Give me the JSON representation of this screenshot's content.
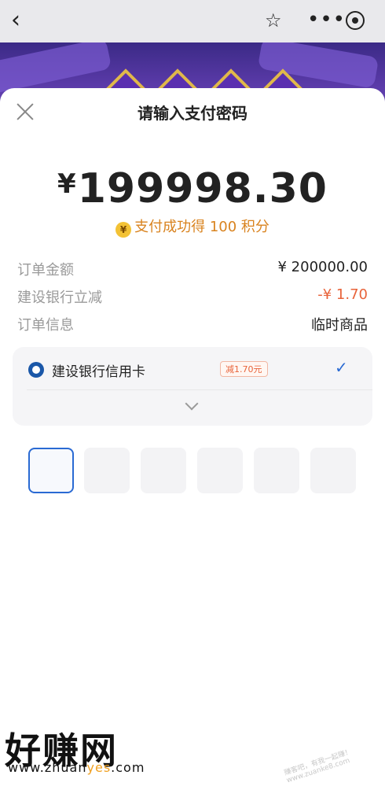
{
  "topbar": {
    "back_icon": "chevron-left-icon",
    "star_icon": "star-icon",
    "more_icon": "more-icon",
    "target_icon": "target-icon"
  },
  "sheet": {
    "title": "请输入支付密码",
    "close_icon": "close-icon"
  },
  "payment": {
    "currency": "¥",
    "amount": "199998.30",
    "reward_icon": "coin-icon",
    "reward_text": "支付成功得 100 积分"
  },
  "details": [
    {
      "label": "订单金额",
      "value": "¥ 200000.00"
    },
    {
      "label": "建设银行立减",
      "value": "-¥ 1.70"
    },
    {
      "label": "订单信息",
      "value": "临时商品"
    }
  ],
  "card": {
    "bank_icon": "ccb-bank-icon",
    "name": "建设银行信用卡",
    "promo": "减1.70元",
    "check_icon": "check-icon",
    "expand_icon": "chevron-down-icon"
  },
  "pin": {
    "digits": 6,
    "filled": 0
  },
  "watermark": {
    "brand": "好赚网",
    "url_prefix": "www.zhuan",
    "url_accent": "yes",
    "url_suffix": ".com",
    "faint": "赚客吧，有我一起赚！ www.zuanke8.com"
  },
  "colors": {
    "accent_blue": "#2a6ad3",
    "discount_orange": "#e8633a",
    "reward_orange": "#d9831f"
  }
}
